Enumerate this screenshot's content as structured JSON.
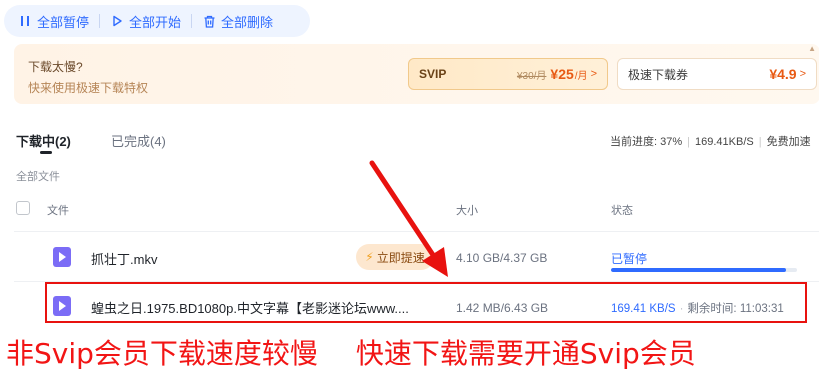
{
  "toolbar": {
    "pause_all": "全部暂停",
    "start_all": "全部开始",
    "delete_all": "全部删除"
  },
  "banner": {
    "title": "下载太慢?",
    "subtitle": "快来使用极速下载特权",
    "svip": {
      "name": "SVIP",
      "old_price": "¥30/月",
      "price": "¥25",
      "unit": "/月",
      "arrow": ">"
    },
    "ticket": {
      "name": "极速下载券",
      "price": "¥4.9",
      "arrow": ">"
    }
  },
  "tabs": {
    "downloading": "下载中(2)",
    "completed": "已完成(4)"
  },
  "progress": {
    "current": "当前进度: 37%",
    "speed": "169.41KB/S",
    "free": "免费加速"
  },
  "list": {
    "section_label": "全部文件",
    "columns": {
      "file": "文件",
      "size": "大小",
      "status": "状态"
    },
    "rows": [
      {
        "name": "抓壮丁.mkv",
        "size": "4.10 GB/4.37 GB",
        "status": "已暂停",
        "progress": 0.94,
        "accelerate": "立即提速"
      },
      {
        "name": "蝗虫之日.1975.BD1080p.中文字幕【老影迷论坛www....",
        "size": "1.42 MB/6.43 GB",
        "speed": "169.41 KB/S",
        "remaining_label": "剩余时间:",
        "remaining": "11:03:31"
      }
    ]
  },
  "caption": {
    "left": "非Svip会员下载速度较慢",
    "right": "快速下载需要开通Svip会员"
  },
  "colors": {
    "accent": "#2f6bff",
    "annotation_red": "#e8120f",
    "price_orange": "#e85a14",
    "file_icon": "#7b6cf6"
  },
  "icons": [
    "pause-icon",
    "play-icon",
    "trash-icon",
    "chevron-right-icon",
    "lightning-icon",
    "video-file-icon",
    "checkbox-icon"
  ]
}
